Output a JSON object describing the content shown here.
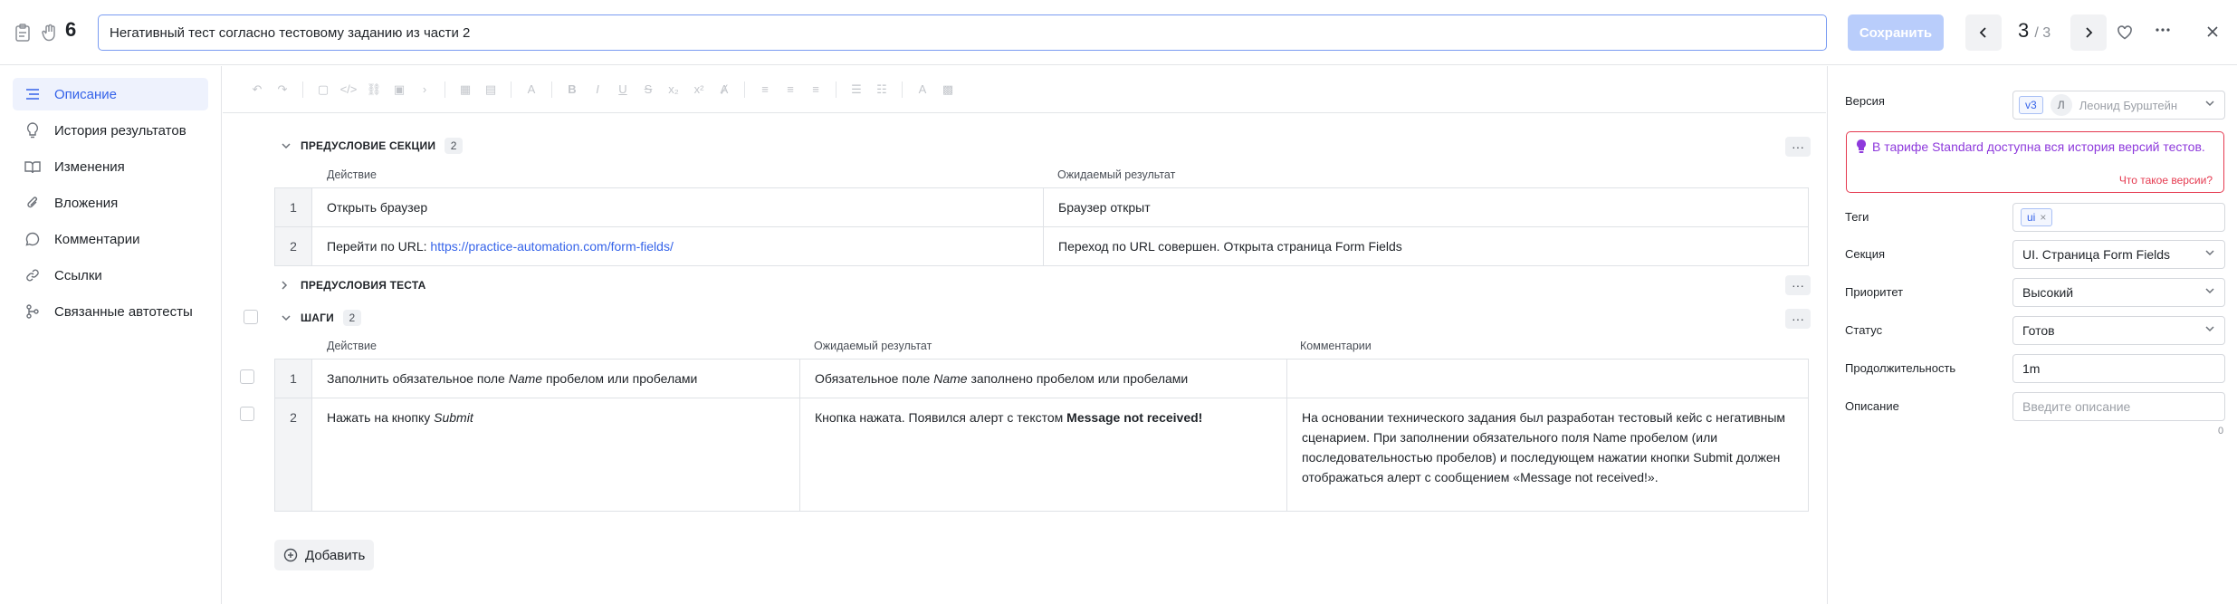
{
  "header": {
    "test_id": "6",
    "title_value": "Негативный тест согласно тестовому заданию из части 2",
    "save_label": "Сохранить",
    "counter_current": "3",
    "counter_total": "/ 3"
  },
  "sidebar": {
    "items": [
      {
        "label": "Описание",
        "icon": "list-icon"
      },
      {
        "label": "История результатов",
        "icon": "lightbulb-icon"
      },
      {
        "label": "Изменения",
        "icon": "book-icon"
      },
      {
        "label": "Вложения",
        "icon": "paperclip-icon"
      },
      {
        "label": "Комментарии",
        "icon": "comment-icon"
      },
      {
        "label": "Ссылки",
        "icon": "link-icon"
      },
      {
        "label": "Связанные автотесты",
        "icon": "hierarchy-icon"
      }
    ]
  },
  "sections": {
    "precondition_section": {
      "title": "ПРЕДУСЛОВИЕ СЕКЦИИ",
      "count": "2",
      "col_action": "Действие",
      "col_expected": "Ожидаемый результат",
      "rows": [
        {
          "num": "1",
          "action": "Открыть браузер",
          "expected": "Браузер открыт"
        },
        {
          "num": "2",
          "action_prefix": "Перейти по URL: ",
          "action_link": "https://practice-automation.com/form-fields/",
          "expected": "Переход по URL совершен. Открыта страница Form Fields"
        }
      ]
    },
    "precondition_test": {
      "title": "ПРЕДУСЛОВИЯ ТЕСТА"
    },
    "steps": {
      "title": "ШАГИ",
      "count": "2",
      "col_action": "Действие",
      "col_expected": "Ожидаемый результат",
      "col_comments": "Комментарии",
      "rows": [
        {
          "num": "1",
          "action_a": "Заполнить обязательное поле ",
          "action_em": "Name",
          "action_b": " пробелом или пробелами",
          "expected_a": "Обязательное поле ",
          "expected_em": "Name",
          "expected_b": " заполнено пробелом или пробелами",
          "comment": ""
        },
        {
          "num": "2",
          "action_a": "Нажать на кнопку ",
          "action_em": "Submit",
          "expected_a": "Кнопка нажата. Появился алерт с текстом ",
          "expected_strong": "Message not received!",
          "comment": "На основании технического задания был разработан тестовый кейс с негативным сценарием. При заполнении обязательного поля Name пробелом (или последовательностью пробелов) и последующем нажатии кнопки Submit должен отображаться алерт с сообщением «Message not received!»."
        }
      ]
    },
    "add_label": "Добавить"
  },
  "properties": {
    "version_label": "Версия",
    "version_chip": "v3",
    "version_avatar": "Л",
    "version_author": "Леонид Бурштейн",
    "promo_text": "В тарифе Standard доступна вся история версий тестов.",
    "promo_link": "Что такое версии?",
    "tags_label": "Теги",
    "tag": "ui",
    "section_label": "Секция",
    "section_value": "UI. Страница Form Fields",
    "priority_label": "Приоритет",
    "priority_value": "Высокий",
    "status_label": "Статус",
    "status_value": "Готов",
    "duration_label": "Продолжительность",
    "duration_value": "1m",
    "description_label": "Описание",
    "description_placeholder": "Введите описание",
    "description_count": "0"
  },
  "colors": {
    "accent": "#3563e9",
    "promo_border": "#e5394f",
    "promo_text": "#8e3adc"
  }
}
